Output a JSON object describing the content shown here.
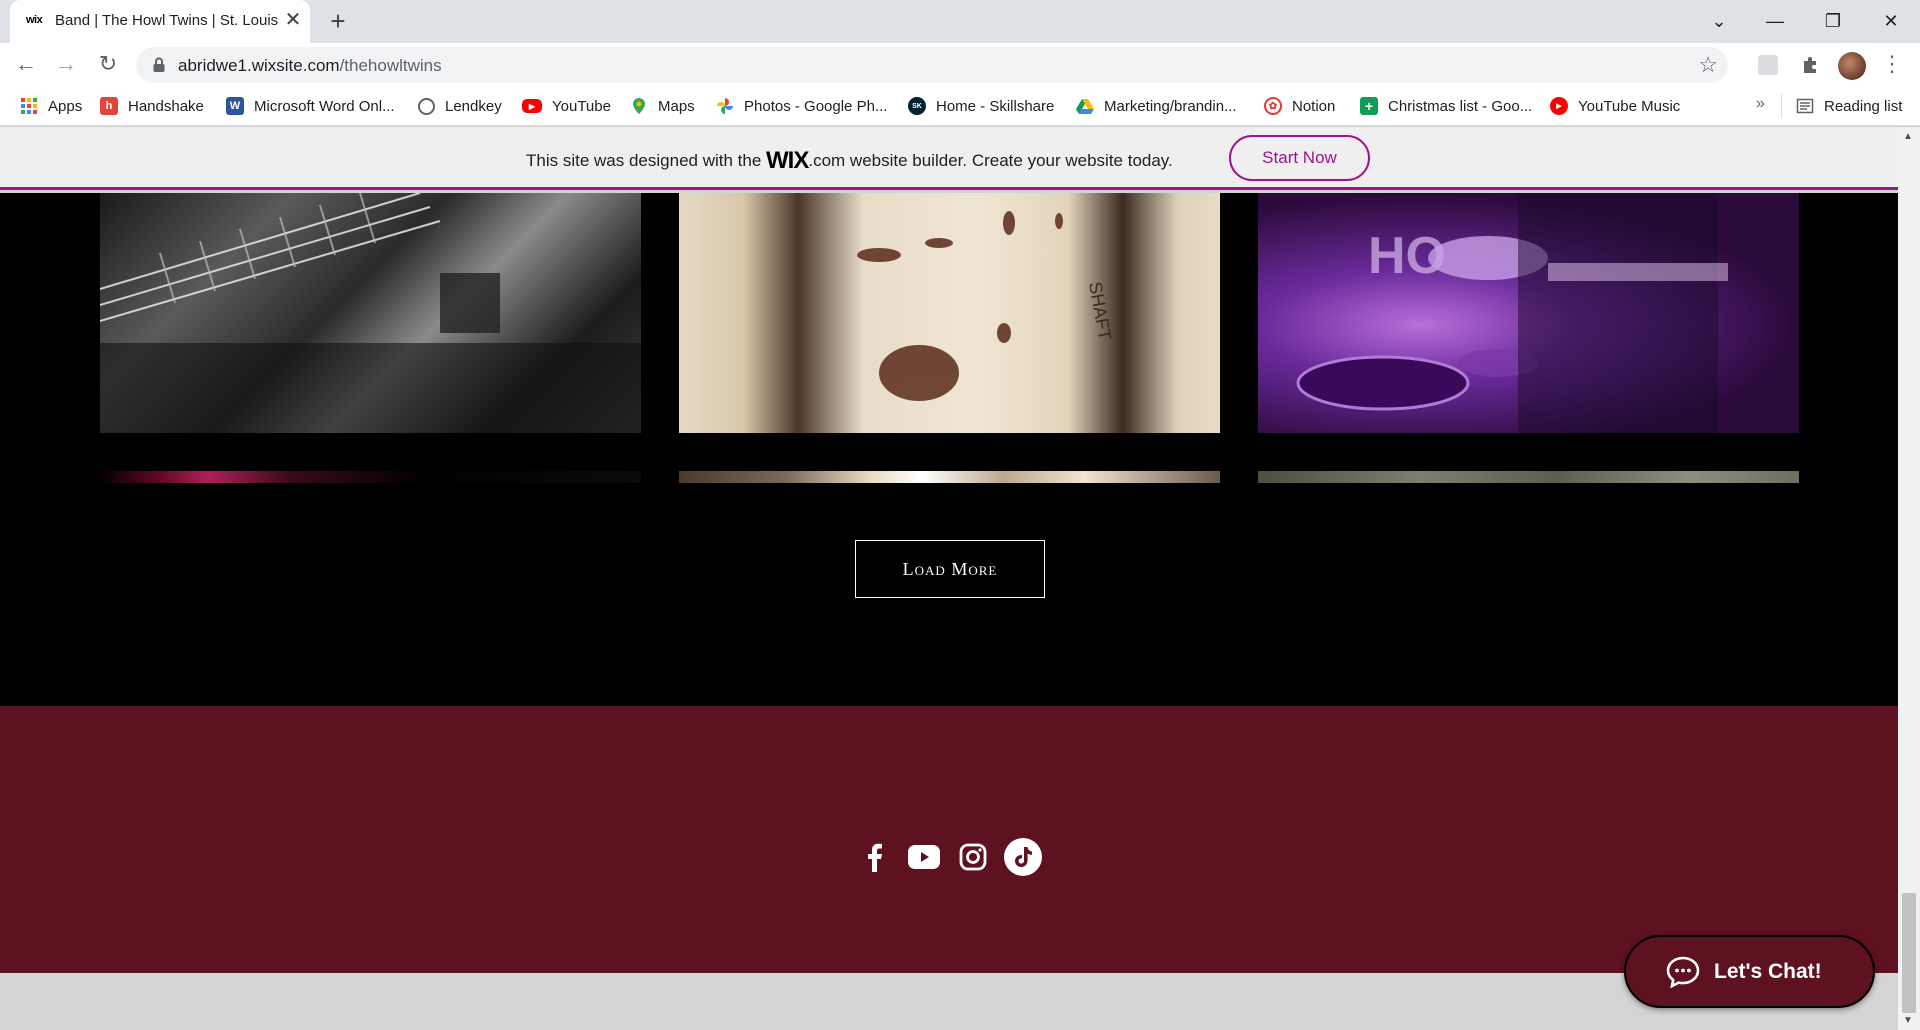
{
  "browser": {
    "tab": {
      "favicon": "wix",
      "title": "Band | The Howl Twins | St. Louis",
      "close": "✕"
    },
    "new_tab": "+",
    "window": {
      "minimize": "—",
      "restore": "❐",
      "close": "✕",
      "tab_search": "⌄"
    },
    "nav": {
      "back": "←",
      "forward": "→",
      "reload": "↻"
    },
    "address": {
      "host": "abridwe1.wixsite.com",
      "path": "/thehowltwins"
    },
    "star": "☆",
    "menu": "⋮"
  },
  "bookmarks": {
    "items": [
      {
        "label": "Apps",
        "icon": "apps-grid-icon",
        "color": "#4285f4"
      },
      {
        "label": "Handshake",
        "icon": "handshake-icon",
        "color": "#e2463b"
      },
      {
        "label": "Microsoft Word Onl...",
        "icon": "word-icon",
        "color": "#2b579a"
      },
      {
        "label": "Lendkey",
        "icon": "globe-icon",
        "color": "#5f6368"
      },
      {
        "label": "YouTube",
        "icon": "youtube-icon",
        "color": "#ff0000"
      },
      {
        "label": "Maps",
        "icon": "maps-icon",
        "color": "#34a853"
      },
      {
        "label": "Photos - Google Ph...",
        "icon": "google-photos-icon",
        "color": "#fbbc04"
      },
      {
        "label": "Home - Skillshare",
        "icon": "skillshare-icon",
        "color": "#002333"
      },
      {
        "label": "Marketing/brandin...",
        "icon": "google-drive-icon",
        "color": "#0f9d58"
      },
      {
        "label": "Notion",
        "icon": "notion-icon",
        "color": "#e53935"
      },
      {
        "label": "Christmas list - Goo...",
        "icon": "google-sheets-icon",
        "color": "#0f9d58"
      },
      {
        "label": "YouTube Music",
        "icon": "youtube-music-icon",
        "color": "#ff0000"
      }
    ],
    "overflow": "»",
    "reading_list": "Reading list"
  },
  "wix_banner": {
    "text_before": "This site was designed with the ",
    "logo": "WIX",
    "logo_suffix": ".com",
    "text_after": " website builder. Create your website today.",
    "cta": "Start Now",
    "accent": "#a0138e"
  },
  "gallery": {
    "load_more": "Load More"
  },
  "footer": {
    "background": "#5e111e",
    "social": [
      "facebook-icon",
      "youtube-icon",
      "instagram-icon",
      "tiktok-icon"
    ]
  },
  "chat": {
    "label": "Let's Chat!"
  }
}
